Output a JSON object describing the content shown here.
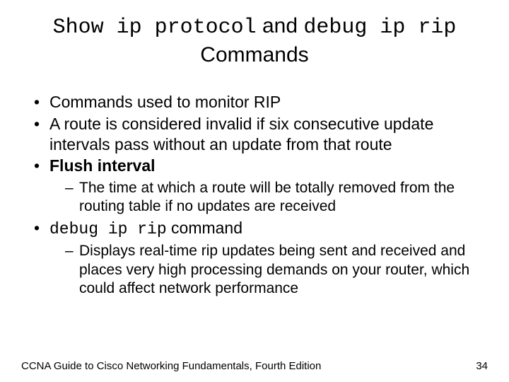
{
  "title": {
    "code1": "Show ip protocol",
    "and": " and ",
    "code2": "debug ip rip",
    "tail": " Commands"
  },
  "bullets": {
    "b1": "Commands used to monitor RIP",
    "b2": "A route is considered invalid if six consecutive update intervals pass without an update from that route",
    "b3": "Flush interval",
    "b3_sub": "The time at which a route will be totally removed from the routing table if no updates are received",
    "b4_code": "debug ip rip",
    "b4_tail": " command",
    "b4_sub": "Displays real-time rip updates being sent and received and places very high processing demands on your router, which could affect network performance"
  },
  "footer": {
    "left": "CCNA Guide to Cisco Networking Fundamentals, Fourth Edition",
    "right": "34"
  }
}
